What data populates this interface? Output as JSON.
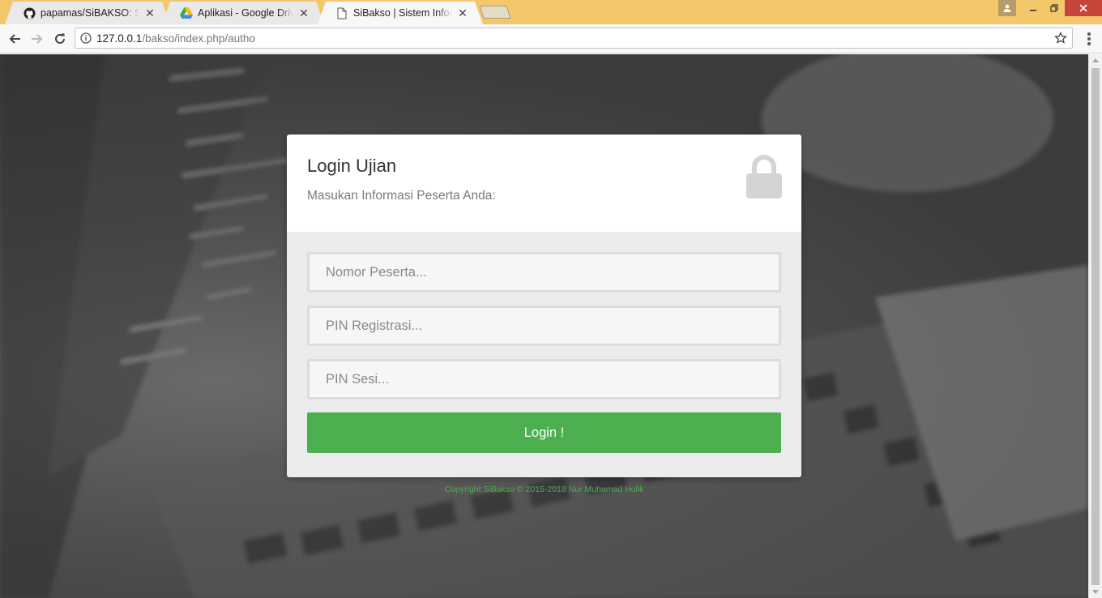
{
  "browser": {
    "tabs": [
      {
        "title": "papamas/SiBAKSO: Sistem Informasi Bank Soal",
        "icon": "github-icon",
        "active": false
      },
      {
        "title": "Aplikasi - Google Drive",
        "icon": "google-drive-icon",
        "active": false
      },
      {
        "title": "SiBakso | Sistem Informasi Bank Soal",
        "icon": "page-icon",
        "active": true
      }
    ],
    "url_host": "127.0.0.1",
    "url_path": "/bakso/index.php/autho",
    "tab_close_glyph": "✕"
  },
  "login": {
    "title": "Login Ujian",
    "subtitle": "Masukan Informasi Peserta Anda:",
    "nomor_placeholder": "Nomor Peserta...",
    "pin_registrasi_placeholder": "PIN Registrasi...",
    "pin_sesi_placeholder": "PIN Sesi...",
    "button_label": "Login !"
  },
  "footer": {
    "prefix": "Copyright ",
    "brand": "SiBakso",
    "suffix": " © 2015-2018 Nur Muhamad Holik"
  },
  "colors": {
    "accent": "#4caf50",
    "tabstrip": "#f2c86a",
    "card_body": "#ececec"
  }
}
